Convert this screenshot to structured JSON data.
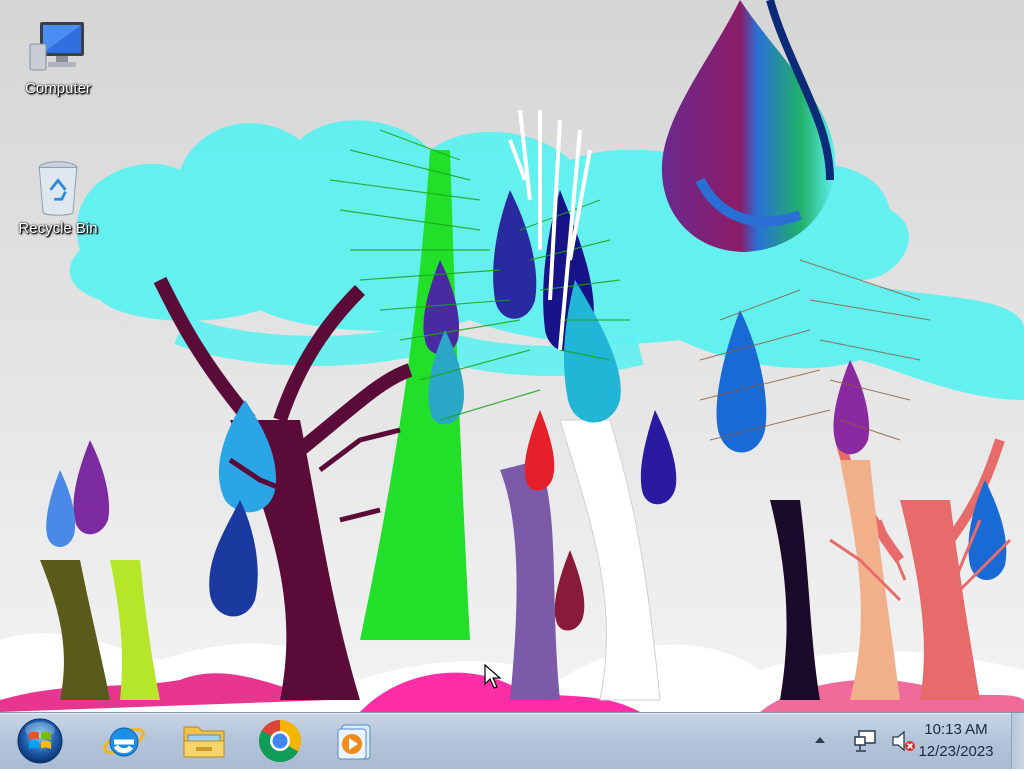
{
  "desktop": {
    "icons": [
      {
        "label": "Computer",
        "icon": "computer-icon"
      },
      {
        "label": "Recycle Bin",
        "icon": "recycle-bin-icon"
      }
    ]
  },
  "taskbar": {
    "start": {
      "icon": "windows-start-icon"
    },
    "pinned": [
      {
        "icon": "internet-explorer-icon"
      },
      {
        "icon": "file-explorer-icon"
      },
      {
        "icon": "chrome-icon"
      },
      {
        "icon": "media-player-icon"
      }
    ],
    "tray": {
      "icons": [
        "show-hidden-icons-arrow-icon",
        "network-icon",
        "volume-muted-icon"
      ],
      "time": "10:13 AM",
      "date": "12/23/2023"
    }
  },
  "colors": {
    "taskbar": "#b4c5da",
    "desktop_bg": "#e9e9e9",
    "cloud": "#5ef0f0"
  }
}
